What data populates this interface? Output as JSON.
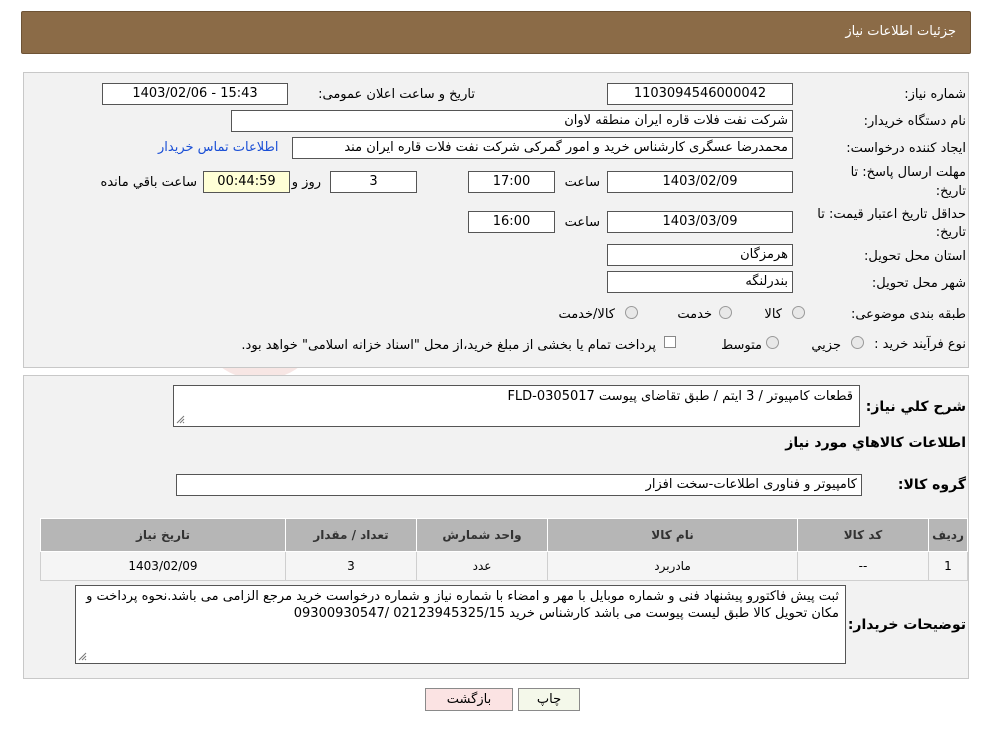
{
  "header": {
    "title": "جزئیات اطلاعات نیاز"
  },
  "watermark": "AriaTender.neT",
  "form": {
    "need_number_label": "شماره نیاز:",
    "need_number": "1103094546000042",
    "announce_label": "تاریخ و ساعت اعلان عمومی:",
    "announce_value": "1403/02/06 - 15:43",
    "buyer_org_label": "نام دستگاه خریدار:",
    "buyer_org": "شرکت نفت فلات قاره ایران منطقه لاوان",
    "creator_label": "ایجاد کننده درخواست:",
    "creator": "محمدرضا عسگری کارشناس خرید و امور گمرکی شرکت نفت فلات قاره ایران مند",
    "contact_link": "اطلاعات تماس خریدار",
    "deadline_label_1": "مهلت ارسال پاسخ: تا",
    "deadline_label_2": "تاریخ:",
    "deadline_date": "1403/02/09",
    "time_label": "ساعت",
    "deadline_time": "17:00",
    "days": "3",
    "days_label": "روز و",
    "remaining": "00:44:59",
    "remaining_label": "ساعت باقي مانده",
    "validity_label_1": "حداقل تاریخ اعتبار قیمت: تا",
    "validity_label_2": "تاریخ:",
    "validity_date": "1403/03/09",
    "validity_time": "16:00",
    "province_label": "استان محل تحویل:",
    "province": "هرمزگان",
    "city_label": "شهر محل تحویل:",
    "city": "بندرلنگه",
    "category_label": "طبقه بندی موضوعی:",
    "category_options": [
      "کالا",
      "خدمت",
      "کالا/خدمت"
    ],
    "process_label": "نوع فرآیند خرید :",
    "process_options": [
      "جزیي",
      "متوسط"
    ],
    "process_note": "پرداخت تمام یا بخشی از مبلغ خرید،از محل \"اسناد خزانه اسلامی\" خواهد بود."
  },
  "details": {
    "summary_label": "شرح کلي نياز:",
    "summary": "قطعات کامپیوتر / 3 ایتم / طبق تقاضای پیوست FLD-0305017",
    "goods_info_title": "اطلاعات کالاهاي مورد نياز",
    "group_label": "گروه کالا:",
    "group": "کامپیوتر و فناوری اطلاعات-سخت افزار",
    "table": {
      "headers": [
        "رديف",
        "کد کالا",
        "نام کالا",
        "واحد شمارش",
        "تعداد / مقدار",
        "تاریخ نیاز"
      ],
      "rows": [
        [
          "1",
          "--",
          "مادربرد",
          "عدد",
          "3",
          "1403/02/09"
        ]
      ]
    },
    "buyer_notes_label": "توضيحات خريدار:",
    "buyer_notes": "ثبت پیش فاکتورو پیشنهاد فنی و شماره موبایل با مهر و امضاء با شماره نیاز و شماره درخواست خرید مرجع الزامی می باشد.نحوه پرداخت و مکان تحویل کالا طبق لیست پیوست می باشد کارشناس خرید 02123945325/15 /09300930547"
  },
  "buttons": {
    "print": "چاپ",
    "back": "بازگشت"
  }
}
